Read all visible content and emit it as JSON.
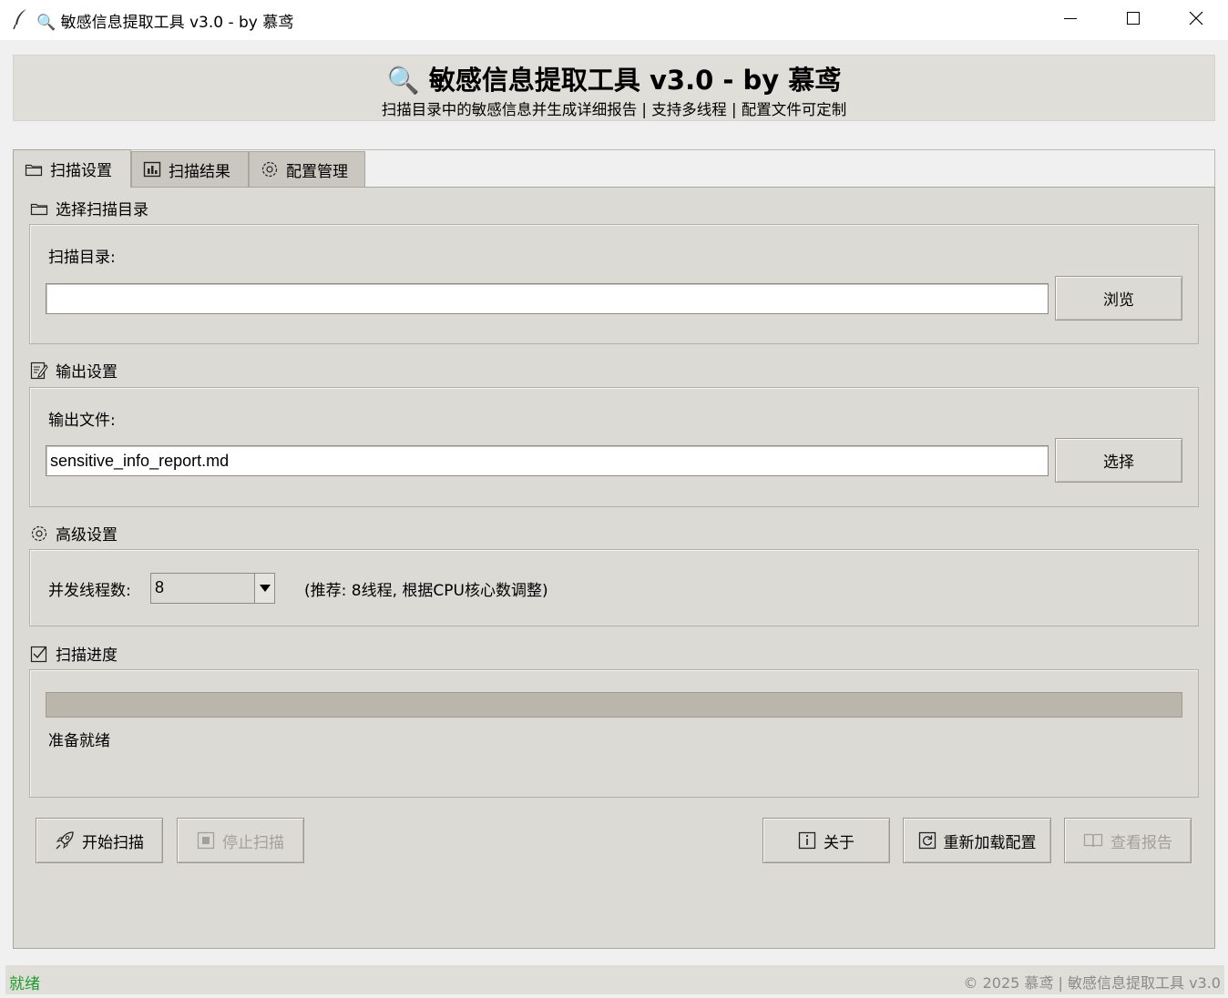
{
  "window": {
    "title": "🔍 敏感信息提取工具 v3.0 - by 慕鸢",
    "app_icon": "feather-icon",
    "controls": [
      "minimize-icon",
      "maximize-icon",
      "close-icon"
    ]
  },
  "header": {
    "title": "🔍 敏感信息提取工具 v3.0 - by 慕鸢",
    "subtitle": "扫描目录中的敏感信息并生成详细报告 | 支持多线程 | 配置文件可定制"
  },
  "tabs": [
    {
      "label": "扫描设置",
      "icon": "folder-icon",
      "selected": true
    },
    {
      "label": "扫描结果",
      "icon": "bar-chart-icon",
      "selected": false
    },
    {
      "label": "配置管理",
      "icon": "gear-icon",
      "selected": false
    }
  ],
  "sections": {
    "directory": {
      "label": "选择扫描目录",
      "field_label": "扫描目录:",
      "value": "",
      "button": "浏览"
    },
    "output": {
      "label": "输出设置",
      "field_label": "输出文件:",
      "value": "sensitive_info_report.md",
      "button": "选择"
    },
    "advanced": {
      "label": "高级设置",
      "field_label": "并发线程数:",
      "threads_value": "8",
      "hint": "(推荐: 8线程, 根据CPU核心数调整)"
    },
    "progress": {
      "label": "扫描进度",
      "value": 0,
      "status": "准备就绪"
    }
  },
  "actions": {
    "start": "开始扫描",
    "stop": "停止扫描",
    "about": "关于",
    "reload": "重新加载配置",
    "view_report": "查看报告"
  },
  "statusbar": {
    "left": "就绪",
    "right": "© 2025 慕鸢 | 敏感信息提取工具 v3.0"
  },
  "colors": {
    "panel_bg": "#dcdad5",
    "status_ok": "#1d9c2c",
    "progress_trough": "#bab6ac"
  }
}
